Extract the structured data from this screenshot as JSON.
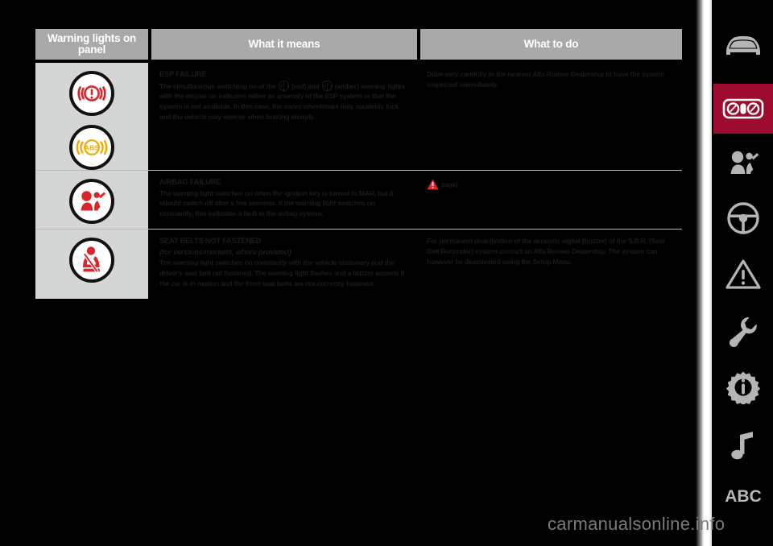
{
  "table": {
    "headers": {
      "col1": "Warning lights on panel",
      "col2": "What it means",
      "col3": "What to do"
    },
    "rows": [
      {
        "lights": [
          "brake-esp-warning-lamp",
          "abs-warning-lamp"
        ],
        "heading": "ESP FAILURE",
        "means_part1": "The simultaneous switching on of the ",
        "means_part2": " (red) and ",
        "means_part3": " (amber) warning lights with the engine on indicates either an anomaly of the ESP system or that the system is not available. In this case, the servo wheelbrake may suddenly lock and the vehicle may swerve when braking sharply.",
        "todo": "Drive very carefully to the nearest Alfa Romeo Dealership to have the system inspected immediately."
      },
      {
        "lights": [
          "airbag-warning-lamp"
        ],
        "heading": "AIRBAG FAILURE",
        "means": "The warning light switches on when the ignition key is turned to MAR, but it should switch off after a few seconds. If the warning light switches on constantly, this indicates a fault in the airbag system.",
        "todo_ref": "page)",
        "todo_icon": "attention-triangle-icon"
      },
      {
        "lights": [
          "seat-belt-warning-lamp"
        ],
        "heading": "SEAT BELTS NOT FASTENED",
        "subheading": "(for versions/markets, where provided)",
        "means": "The warning light switches on constantly with the vehicle stationary and the driver's seat belt not fastened. The warning light flashes and a buzzer sounds if the car is in motion and the front seat belts are not correctly fastened.",
        "todo": "For permanent deactivation of the acoustic signal (buzzer) of the S.B.R. (Seat Belt Reminder) system contact an Alfa Romeo Dealership. The system can however be deactivated using the Setup Menu."
      }
    ]
  },
  "sidebar": {
    "items": [
      {
        "name": "car-icon",
        "active": false
      },
      {
        "name": "dashboard-icon",
        "active": true
      },
      {
        "name": "airbag-icon",
        "active": false
      },
      {
        "name": "steering-wheel-icon",
        "active": false
      },
      {
        "name": "warning-triangle-icon",
        "active": false
      },
      {
        "name": "wrench-icon",
        "active": false
      },
      {
        "name": "gear-info-icon",
        "active": false
      },
      {
        "name": "music-note-icon",
        "active": false
      },
      {
        "name": "abc-label",
        "label": "ABC",
        "active": false
      }
    ]
  },
  "watermark": {
    "text": "carmanualsonline.info"
  },
  "colors": {
    "accent": "#9e0b30",
    "header_bg": "#a9a9a9",
    "icon_cell_bg": "#d4d6d6",
    "warning_red": "#d9262c",
    "warning_amber": "#f0ab00",
    "page_bg": "#000000"
  }
}
